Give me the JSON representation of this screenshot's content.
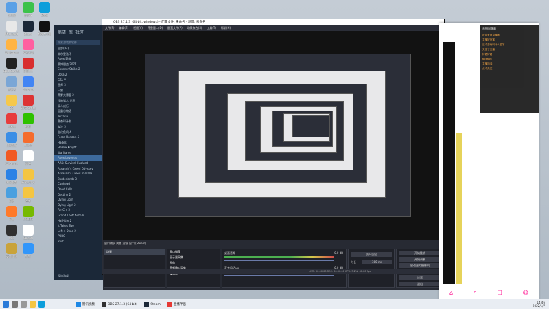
{
  "desktop": {
    "icons": [
      {
        "label": "此电脑",
        "color": "#5aa0e6"
      },
      {
        "label": "Microsoft",
        "color": "#e8e8e8"
      },
      {
        "label": "Wallpaper",
        "color": "#ffb443"
      },
      {
        "label": "Epic Games",
        "color": "#222"
      },
      {
        "label": "回收站",
        "color": "#7aa6d6"
      },
      {
        "label": "QQ",
        "color": "#f5c84b"
      },
      {
        "label": "网易云",
        "color": "#e73c3c"
      },
      {
        "label": "控制面板",
        "color": "#3a8ee6"
      },
      {
        "label": "WeGame",
        "color": "#f15a24"
      },
      {
        "label": "腾讯视频",
        "color": "#2b82e6"
      },
      {
        "label": "网络",
        "color": "#4aa0e0"
      },
      {
        "label": "迅雷",
        "color": "#ff7a2a"
      },
      {
        "label": "OBS",
        "color": "#303030"
      },
      {
        "label": "英雄联盟",
        "color": "#c9a33b"
      },
      {
        "label": "爱奇艺",
        "color": "#3cc24a"
      },
      {
        "label": "Steam",
        "color": "#1b2838"
      },
      {
        "label": "哔哩哔哩",
        "color": "#ff5fa0"
      },
      {
        "label": "网易UU",
        "color": "#d82e2e"
      },
      {
        "label": "Chrome",
        "color": "#4285f4"
      },
      {
        "label": "WPS Office",
        "color": "#d33"
      },
      {
        "label": "微信",
        "color": "#2dc100"
      },
      {
        "label": "Origin",
        "color": "#f56c2d"
      },
      {
        "label": "剪映",
        "color": "#fff"
      },
      {
        "label": "新建文件夹",
        "color": "#f4c542"
      },
      {
        "label": "视频",
        "color": "#f4c542"
      },
      {
        "label": "NVIDIA",
        "color": "#76b900"
      },
      {
        "label": "Ubisoft",
        "color": "#fff"
      },
      {
        "label": "钉钉",
        "color": "#3296fa"
      },
      {
        "label": "Edge",
        "color": "#0c9edb"
      },
      {
        "label": "剪映专业版",
        "color": "#111"
      }
    ]
  },
  "steam": {
    "tab1": "商店",
    "tab2": "库",
    "tab3": "社区",
    "search": "搜索游戏和软件",
    "games": [
      "全部(84)",
      "艾尔登法环",
      "Apex 英雄",
      "赛博朋克 2077",
      "Counter-Strike 2",
      "Dota 2",
      "GTA V",
      "巫师 3",
      "只狼",
      "荒野大镖客 2",
      "怪物猎人 世界",
      "双人成行",
      "星露谷物语",
      "Terraria",
      "戴森球计划",
      "鬼泣 5",
      "生化危机 4",
      "Forza Horizon 5",
      "Hades",
      "Hollow Knight",
      "Warframe",
      "Apex Legends",
      "ARK: Survival Evolved",
      "Assassin's Creed Odyssey",
      "Assassin's Creed Valhalla",
      "Borderlands 3",
      "Cuphead",
      "Dead Cells",
      "Destiny 2",
      "Dying Light",
      "Dying Light 2",
      "Far Cry 5",
      "Grand Theft Auto V",
      "Half-Life 2",
      "It Takes Two",
      "Left 4 Dead 2",
      "PUBG",
      "Rust"
    ],
    "selected_index": 21,
    "footer": "添加游戏"
  },
  "obs": {
    "title": "OBS 27.1.3 (64-bit, windows) - 配置文件: 未命名 - 场景: 未命名",
    "menu": [
      "文件(F)",
      "编辑(E)",
      "视图(V)",
      "停靠窗口(D)",
      "配置文件(P)",
      "场景集合(S)",
      "工具(T)",
      "帮助(H)"
    ],
    "source_bar": "窗口捕获  属性  滤镜  窗口 [Steam]",
    "docks": {
      "scenes": "场景",
      "sources": "来源",
      "mixer": "混音器",
      "transitions": "转场特效",
      "controls": "控制"
    },
    "scene_items": [
      "场景"
    ],
    "source_items": [
      "窗口捕获",
      "显示器采集",
      "图像",
      "音频输入采集",
      "媒体源"
    ],
    "mixer": [
      {
        "name": "桌面音频",
        "db": "0.0 dB"
      },
      {
        "name": "麦克风/Aux",
        "db": "0.0 dB"
      }
    ],
    "transition": {
      "type": "淡入淡出",
      "duration_label": "时长",
      "duration": "300 ms"
    },
    "controls": [
      "开始推流",
      "开始录制",
      "启动虚拟摄像机",
      "工作室模式",
      "设置",
      "退出"
    ],
    "status": "LIVE: 00:00:00   REC: 00:00:00   CPU: 3.2%, 60.00 fps"
  },
  "chat": {
    "title": "直播间弹幕",
    "messages": [
      "欢迎来到直播间",
      "主播好厉害",
      "这个游戏叫什么名字",
      "关注了主播",
      "好看好看",
      "666666",
      "主播加油",
      "点个关注"
    ]
  },
  "taskbar": {
    "apps": [
      "腾讯视频",
      "OBS 27.1.3 (64-bit)",
      "Steam",
      "直播伴侣"
    ],
    "time": "14:46",
    "date": "2022/1/7"
  }
}
